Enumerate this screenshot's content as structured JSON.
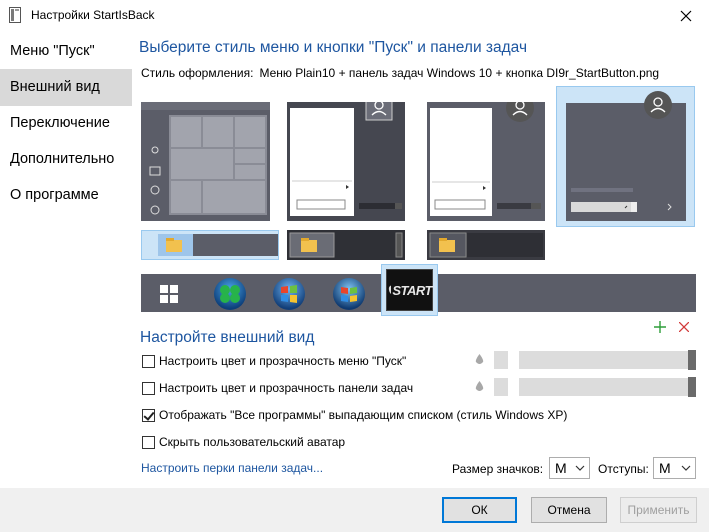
{
  "window": {
    "title": "Настройки StartIsBack"
  },
  "sidebar": {
    "items": [
      {
        "label": "Меню \"Пуск\""
      },
      {
        "label": "Внешний вид"
      },
      {
        "label": "Переключение"
      },
      {
        "label": "Дополнительно"
      },
      {
        "label": "О программе"
      }
    ],
    "selected_index": 1
  },
  "main": {
    "heading": "Выберите стиль меню и кнопки \"Пуск\" и панели задач",
    "style_label": "Стиль оформления:",
    "style_value": "Меню Plain10 + панель задач Windows 10 + кнопка DI9r_StartButton.png",
    "start_button_text": "START",
    "customize_heading": "Настройте внешний вид",
    "options": [
      {
        "label": "Настроить цвет и прозрачность меню \"Пуск\"",
        "checked": false
      },
      {
        "label": "Настроить цвет и прозрачность панели задач",
        "checked": false
      },
      {
        "label": "Отображать \"Все программы\" выпадающим списком (стиль Windows XP)",
        "checked": true
      },
      {
        "label": "Скрыть пользовательский аватар",
        "checked": false
      }
    ],
    "taskbar_perks_link": "Настроить перки панели задач...",
    "icon_size_label": "Размер значков:",
    "icon_size_value": "M",
    "margins_label": "Отступы:",
    "margins_value": "M",
    "colors": {
      "accent": "#1e56a0",
      "add": "#2e9e3a",
      "remove": "#d23a3a",
      "selected_tile": "#cce4f7"
    }
  },
  "footer": {
    "ok_label": "ОК",
    "cancel_label": "Отмена",
    "apply_label": "Применить"
  }
}
